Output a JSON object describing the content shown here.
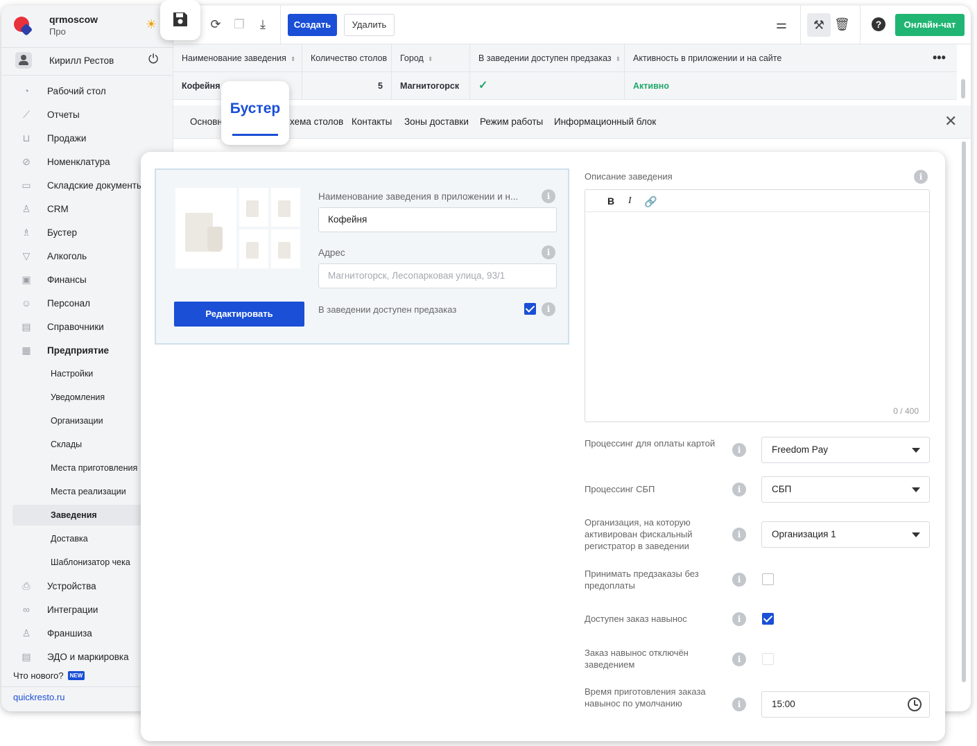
{
  "brand": {
    "name": "qrmoscow",
    "plan": "Про"
  },
  "user": {
    "name": "Кирилл Рестов"
  },
  "nav": [
    {
      "label": "Рабочий стол",
      "icon": "◔"
    },
    {
      "label": "Отчеты",
      "icon": "⟋"
    },
    {
      "label": "Продажи",
      "icon": "⊔"
    },
    {
      "label": "Номенклатура",
      "icon": "⊘"
    },
    {
      "label": "Складские документы",
      "icon": "▭"
    },
    {
      "label": "CRM",
      "icon": "♙"
    },
    {
      "label": "Бустер",
      "icon": "♗"
    },
    {
      "label": "Алкоголь",
      "icon": "▽"
    },
    {
      "label": "Финансы",
      "icon": "▣"
    },
    {
      "label": "Персонал",
      "icon": "☺"
    },
    {
      "label": "Справочники",
      "icon": "▤"
    },
    {
      "label": "Предприятие",
      "icon": "▦"
    }
  ],
  "subnav": [
    "Настройки",
    "Уведомления",
    "Организации",
    "Склады",
    "Места приготовления",
    "Места реализации",
    "Заведения",
    "Доставка",
    "Шаблонизатор чека"
  ],
  "nav_bottom": [
    {
      "label": "Устройства",
      "icon": "⎙"
    },
    {
      "label": "Интеграции",
      "icon": "∞"
    },
    {
      "label": "Франшиза",
      "icon": "♙"
    },
    {
      "label": "ЭДО и маркировка",
      "icon": "▤"
    }
  ],
  "whats_new": "Что нового?",
  "new_badge": "NEW",
  "site": "quickresto.ru",
  "toolbar": {
    "create": "Создать",
    "delete": "Удалить",
    "chat": "Онлайн-чат"
  },
  "grid": {
    "headers": [
      "Наименование заведения",
      "Количество столов",
      "Город",
      "В заведении доступен предзаказ",
      "Активность в приложении и на сайте"
    ],
    "row": {
      "name": "Кофейня",
      "tables": "5",
      "city": "Магнитогорск",
      "preorder": "✓",
      "activity": "Активно"
    }
  },
  "tabs": [
    "Основн",
    "хема столов",
    "Контакты",
    "Зоны доставки",
    "Режим работы",
    "Информационный блок"
  ],
  "active_tab": "Бустер",
  "form": {
    "name_label": "Наименование заведения в приложении и н...",
    "name_value": "Кофейня",
    "address_label": "Адрес",
    "address_placeholder": "Магнитогорск, Лесопарковая улица, 93/1",
    "preorder_label": "В заведении доступен предзаказ",
    "edit_button": "Редактировать",
    "desc_label": "Описание заведения",
    "counter": "0 / 400",
    "card_proc_label": "Процессинг для оплаты картой",
    "card_proc_value": "Freedom Pay",
    "sbp_label": "Процессинг СБП",
    "sbp_value": "СБП",
    "org_label": "Организация, на которую активирован фискальный регистратор в заведении",
    "org_value": "Организация 1",
    "no_prepay_label": "Принимать предзаказы без предоплаты",
    "takeaway_label": "Доступен заказ навынос",
    "takeaway_off_label": "Заказ навынос отключён заведением",
    "prep_time_label": "Время приготовления заказа навынос по умолчанию",
    "prep_time_value": "15:00"
  },
  "colors": {
    "accent": "#1a4fd6",
    "chat": "#21b573",
    "active": "#21a86a"
  }
}
